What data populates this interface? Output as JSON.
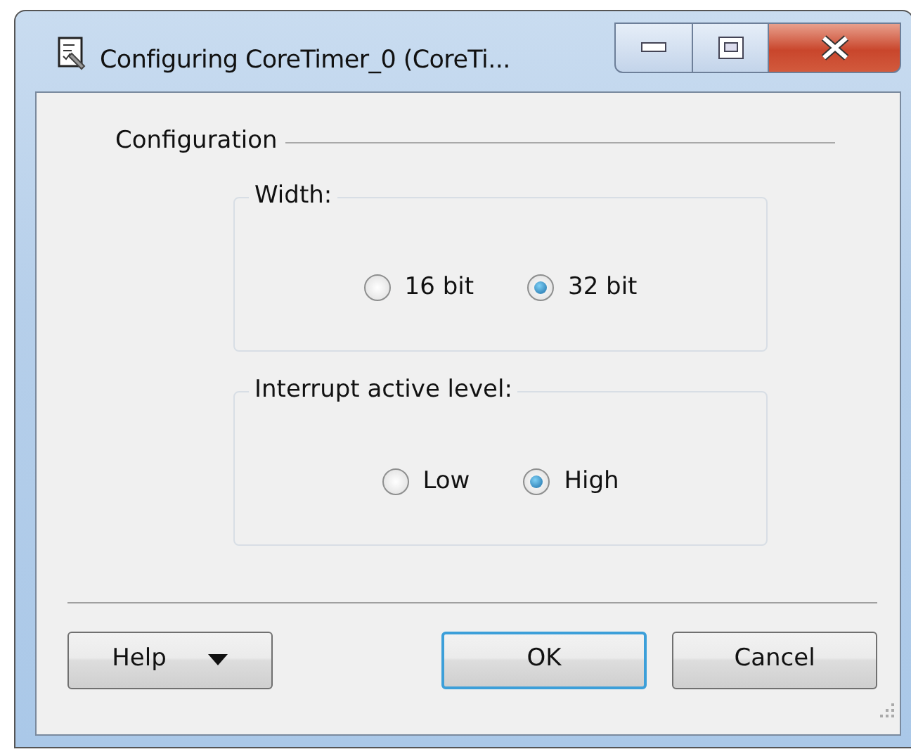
{
  "window": {
    "title": "Configuring CoreTimer_0 (CoreTi..."
  },
  "section": {
    "title": "Configuration"
  },
  "groups": [
    {
      "title": "Width:",
      "options": [
        {
          "label": "16 bit",
          "selected": false
        },
        {
          "label": "32 bit",
          "selected": true
        }
      ]
    },
    {
      "title": "Interrupt active level:",
      "options": [
        {
          "label": "Low",
          "selected": false
        },
        {
          "label": "High",
          "selected": true
        }
      ]
    }
  ],
  "buttons": [
    {
      "label": "Help",
      "kind": "dropdown",
      "default": false
    },
    {
      "label": "OK",
      "kind": "push",
      "default": true
    },
    {
      "label": "Cancel",
      "kind": "push",
      "default": false
    }
  ]
}
